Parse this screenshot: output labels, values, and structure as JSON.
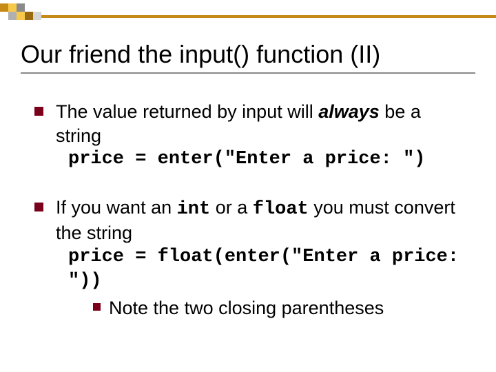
{
  "title": "Our friend the input() function (II)",
  "bullets": [
    {
      "text_before": "The value returned by input will ",
      "emph": "always",
      "text_after": " be a string",
      "code": "price = enter(\"Enter a price: \")"
    },
    {
      "text_before": "If you want an ",
      "code_inline_1": "int",
      "text_mid": " or a ",
      "code_inline_2": "float",
      "text_after": " you must convert the string",
      "code": "price = float(enter(\"Enter a price: \"))",
      "sub": "Note the two closing parentheses"
    }
  ]
}
